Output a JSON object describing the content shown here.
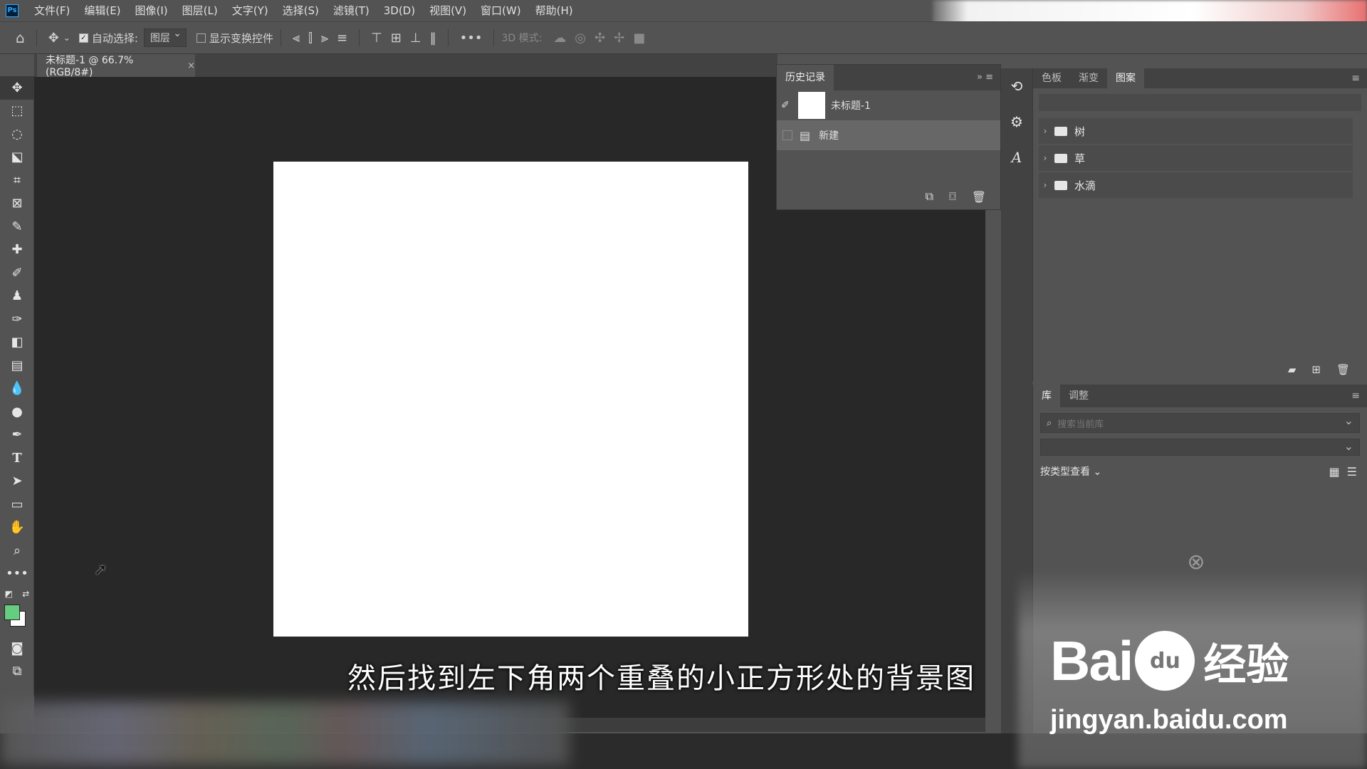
{
  "app": {
    "logo": "Ps"
  },
  "menu": [
    "文件(F)",
    "编辑(E)",
    "图像(I)",
    "图层(L)",
    "文字(Y)",
    "选择(S)",
    "滤镜(T)",
    "3D(D)",
    "视图(V)",
    "窗口(W)",
    "帮助(H)"
  ],
  "options": {
    "auto_select_label": "自动选择:",
    "auto_select_value": "图层",
    "show_transform_label": "显示变换控件",
    "mode_3d_label": "3D 模式:",
    "more": "•••"
  },
  "document": {
    "tab_title": "未标题-1 @ 66.7%(RGB/8#)",
    "close_icon": "×"
  },
  "history": {
    "tab": "历史记录",
    "snapshot_name": "未标题-1",
    "steps": [
      "新建"
    ]
  },
  "patterns_panel": {
    "tabs": [
      "色板",
      "渐变",
      "图案"
    ],
    "active_tab": "图案",
    "groups": [
      "树",
      "草",
      "水滴"
    ]
  },
  "library_panel": {
    "tabs": [
      "库",
      "调整"
    ],
    "active_tab": "库",
    "search_placeholder": "搜索当前库",
    "view_by_label": "按类型查看"
  },
  "colors": {
    "foreground": "#66cc80",
    "background": "#ffffff",
    "canvas_bg": "#282828",
    "panel_bg": "#535353"
  },
  "subtitle": "然后找到左下角两个重叠的小正方形处的背景图",
  "watermark": {
    "brand_left": "Bai",
    "brand_paw": "du",
    "brand_right": "经验",
    "url": "jingyan.baidu.com"
  }
}
